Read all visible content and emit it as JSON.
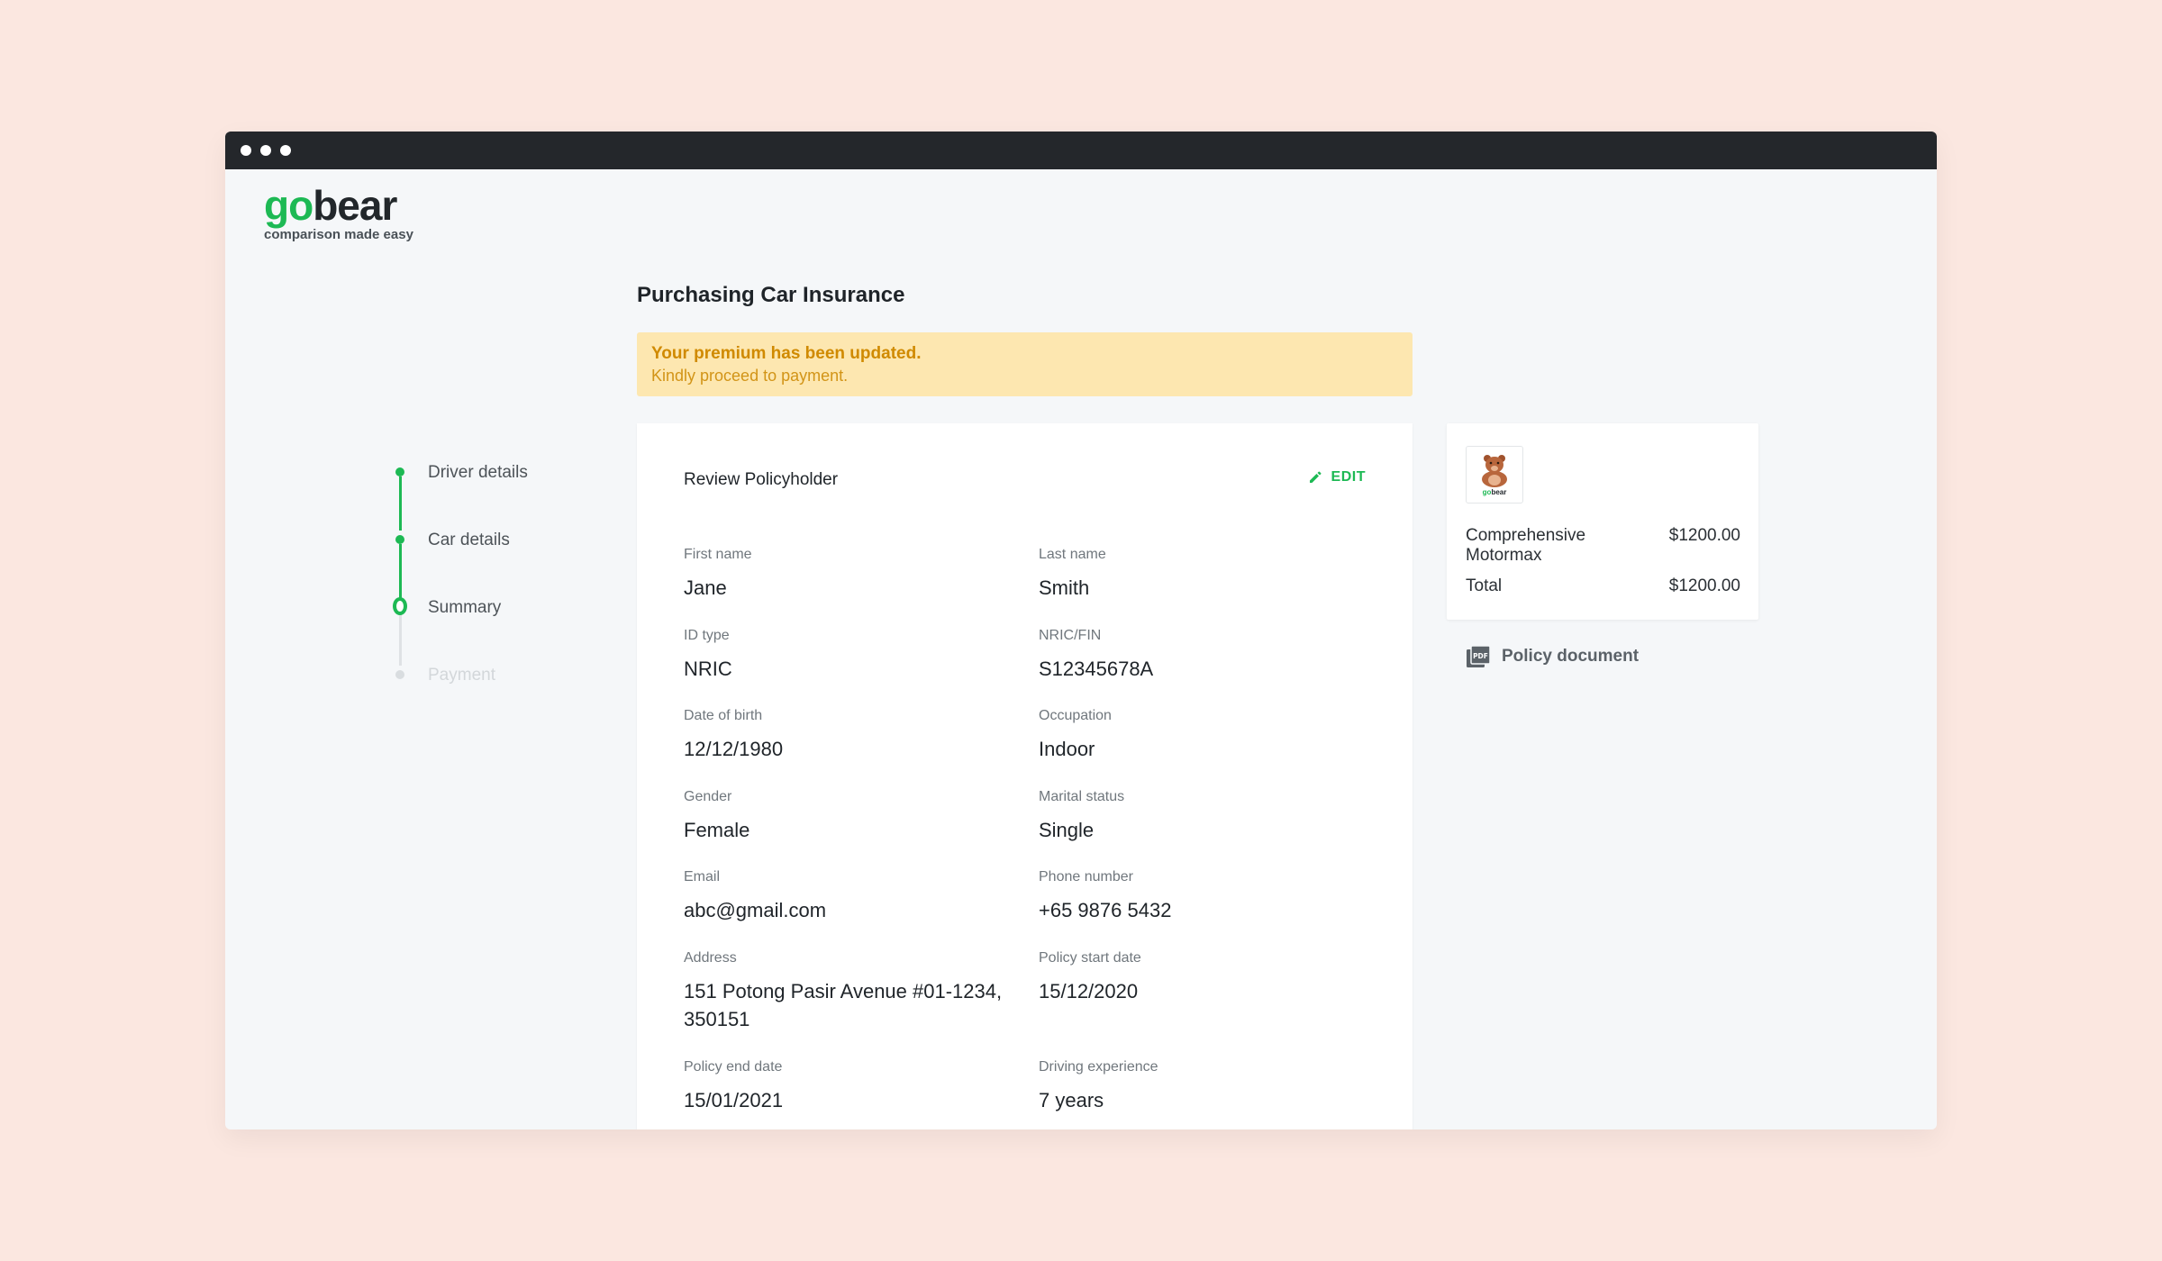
{
  "brand": {
    "go": "go",
    "bear": "bear",
    "tagline": "comparison made easy",
    "mini_go": "go",
    "mini_bear": "bear"
  },
  "stepper": {
    "steps": [
      {
        "label": "Driver details",
        "state": "done"
      },
      {
        "label": "Car details",
        "state": "done"
      },
      {
        "label": "Summary",
        "state": "current"
      },
      {
        "label": "Payment",
        "state": "upcoming"
      }
    ]
  },
  "main": {
    "title": "Purchasing Car Insurance",
    "alert": {
      "title": "Your premium has been updated.",
      "text": "Kindly proceed to payment."
    },
    "card": {
      "heading": "Review Policyholder",
      "edit_label": "EDIT",
      "fields": [
        {
          "label": "First name",
          "value": "Jane"
        },
        {
          "label": "Last name",
          "value": "Smith"
        },
        {
          "label": "ID type",
          "value": "NRIC"
        },
        {
          "label": "NRIC/FIN",
          "value": "S12345678A"
        },
        {
          "label": "Date of birth",
          "value": "12/12/1980"
        },
        {
          "label": "Occupation",
          "value": "Indoor"
        },
        {
          "label": "Gender",
          "value": "Female"
        },
        {
          "label": "Marital status",
          "value": "Single"
        },
        {
          "label": "Email",
          "value": "abc@gmail.com"
        },
        {
          "label": "Phone number",
          "value": "+65 9876 5432"
        },
        {
          "label": "Address",
          "value": "151 Potong Pasir Avenue #01-1234, 350151"
        },
        {
          "label": "Policy start date",
          "value": "15/12/2020"
        },
        {
          "label": "Policy end date",
          "value": "15/01/2021"
        },
        {
          "label": "Driving experience",
          "value": "7 years"
        }
      ]
    }
  },
  "summary": {
    "plan_name": "Comprehensive Motormax",
    "plan_price": "$1200.00",
    "total_label": "Total",
    "total_price": "$1200.00"
  },
  "policy_document": {
    "label": "Policy document",
    "icon": "pdf-icon"
  },
  "colors": {
    "accent": "#1db954",
    "alert_bg": "#fde7b0",
    "alert_text": "#d08a00",
    "background": "#fbe7e0",
    "titlebar": "#24272b"
  }
}
